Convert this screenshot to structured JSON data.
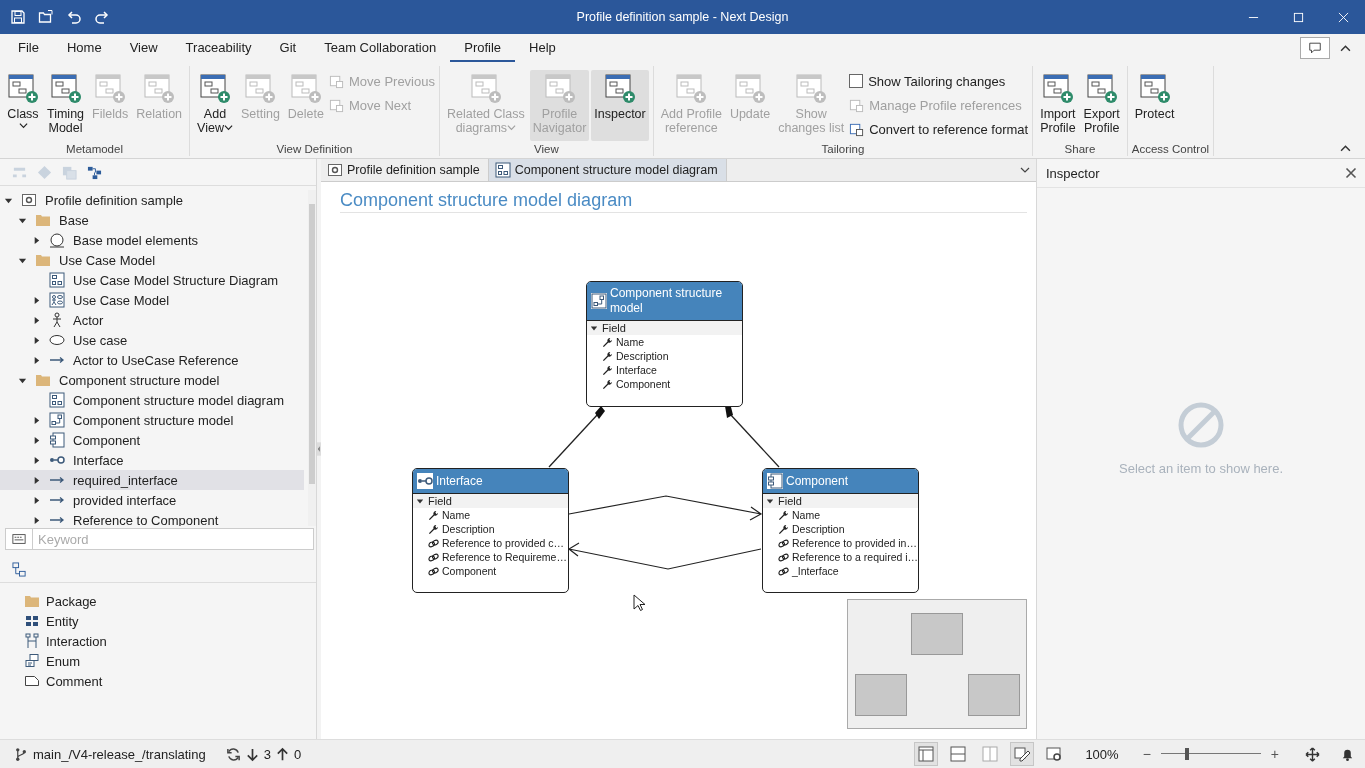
{
  "window": {
    "title": "Profile definition sample - Next Design"
  },
  "menu_tabs": [
    {
      "label": "File",
      "selected": false
    },
    {
      "label": "Home",
      "selected": false
    },
    {
      "label": "View",
      "selected": false
    },
    {
      "label": "Traceability",
      "selected": false
    },
    {
      "label": "Git",
      "selected": false
    },
    {
      "label": "Team Collaboration",
      "selected": false
    },
    {
      "label": "Profile",
      "selected": true
    },
    {
      "label": "Help",
      "selected": false
    }
  ],
  "ribbon_groups": [
    {
      "label": "Metamodel",
      "items": [
        {
          "kind": "large",
          "label": "Class",
          "disabled": false,
          "dropdown": true,
          "pressed": false
        },
        {
          "kind": "large",
          "label": "Timing\nModel",
          "disabled": false,
          "dropdown": false,
          "pressed": false
        },
        {
          "kind": "large",
          "label": "Filelds",
          "disabled": true,
          "dropdown": false,
          "pressed": false
        },
        {
          "kind": "large",
          "label": "Relation",
          "disabled": true,
          "dropdown": false,
          "pressed": false
        }
      ]
    },
    {
      "label": "View Definition",
      "items": [
        {
          "kind": "large",
          "label": "Add\nView",
          "disabled": false,
          "dropdown": true,
          "pressed": false
        },
        {
          "kind": "large",
          "label": "Setting",
          "disabled": true,
          "dropdown": false,
          "pressed": false
        },
        {
          "kind": "large",
          "label": "Delete",
          "disabled": true,
          "dropdown": false,
          "pressed": false
        },
        {
          "kind": "small",
          "label": "Move Previous",
          "disabled": true
        },
        {
          "kind": "small",
          "label": "Move Next",
          "disabled": true
        }
      ]
    },
    {
      "label": "View",
      "items": [
        {
          "kind": "large",
          "label": "Related Class\ndiagrams",
          "disabled": true,
          "dropdown": true,
          "pressed": false
        },
        {
          "kind": "large",
          "label": "Profile\nNavigator",
          "disabled": true,
          "dropdown": false,
          "pressed": true
        },
        {
          "kind": "large",
          "label": "Inspector",
          "disabled": false,
          "dropdown": false,
          "pressed": true
        }
      ]
    },
    {
      "label": "Tailoring",
      "items": [
        {
          "kind": "large",
          "label": "Add Profile\nreference",
          "disabled": true,
          "dropdown": false,
          "pressed": false
        },
        {
          "kind": "large",
          "label": "Update",
          "disabled": true,
          "dropdown": false,
          "pressed": false
        },
        {
          "kind": "large",
          "label": "Show\nchanges list",
          "disabled": true,
          "dropdown": false,
          "pressed": false
        },
        {
          "kind": "checkbox",
          "label": "Show Tailoring changes",
          "disabled": false,
          "checked": false
        },
        {
          "kind": "small",
          "label": "Manage Profile references",
          "disabled": true
        },
        {
          "kind": "small",
          "label": "Convert to reference format",
          "disabled": false
        }
      ]
    },
    {
      "label": "Share",
      "items": [
        {
          "kind": "large",
          "label": "Import\nProfile",
          "disabled": false,
          "dropdown": false,
          "pressed": false
        },
        {
          "kind": "large",
          "label": "Export\nProfile",
          "disabled": false,
          "dropdown": false,
          "pressed": false
        }
      ]
    },
    {
      "label": "Access Control",
      "items": [
        {
          "kind": "large",
          "label": "Protect",
          "disabled": false,
          "dropdown": false,
          "pressed": false
        }
      ]
    }
  ],
  "tree": [
    {
      "label": "Profile definition sample",
      "kind": "profile",
      "expanded": true,
      "selected": false,
      "children": [
        {
          "label": "Base",
          "kind": "folder",
          "expanded": true,
          "selected": false,
          "children": [
            {
              "label": "Base model elements",
              "kind": "base",
              "expanded": false,
              "selected": false
            }
          ]
        },
        {
          "label": "Use Case Model",
          "kind": "folder",
          "expanded": true,
          "selected": false,
          "children": [
            {
              "label": "Use Case Model Structure Diagram",
              "kind": "diagram",
              "selected": false
            },
            {
              "label": "Use Case Model",
              "kind": "usecase-model",
              "expanded": false,
              "selected": false
            },
            {
              "label": "Actor",
              "kind": "actor",
              "expanded": false,
              "selected": false
            },
            {
              "label": "Use case",
              "kind": "usecase",
              "expanded": false,
              "selected": false
            },
            {
              "label": "Actor to UseCase Reference",
              "kind": "reference",
              "expanded": false,
              "selected": false
            }
          ]
        },
        {
          "label": "Component structure model",
          "kind": "folder",
          "expanded": true,
          "selected": false,
          "children": [
            {
              "label": "Component structure model diagram",
              "kind": "diagram",
              "selected": false
            },
            {
              "label": "Component structure model",
              "kind": "structure-model",
              "expanded": false,
              "selected": false
            },
            {
              "label": "Component",
              "kind": "component",
              "expanded": false,
              "selected": false
            },
            {
              "label": "Interface",
              "kind": "interface",
              "expanded": false,
              "selected": false
            },
            {
              "label": "required_interface",
              "kind": "reference",
              "expanded": false,
              "selected": true
            },
            {
              "label": "provided interface",
              "kind": "reference",
              "expanded": false,
              "selected": false
            },
            {
              "label": "Reference to Component",
              "kind": "reference",
              "expanded": false,
              "selected": false
            }
          ]
        }
      ]
    }
  ],
  "keyword": {
    "placeholder": "Keyword"
  },
  "palette": [
    {
      "label": "Package",
      "kind": "package"
    },
    {
      "label": "Entity",
      "kind": "entity"
    },
    {
      "label": "Interaction",
      "kind": "interaction"
    },
    {
      "label": "Enum",
      "kind": "enum"
    },
    {
      "label": "Comment",
      "kind": "comment"
    }
  ],
  "editor_tabs": [
    {
      "label": "Profile definition sample",
      "kind": "profile",
      "selected": false
    },
    {
      "label": "Component structure model diagram",
      "kind": "diagram",
      "selected": true
    }
  ],
  "diagram": {
    "title": "Component structure model diagram",
    "nodes": [
      {
        "title": "Component structure model",
        "kind": "structure-model",
        "section": "Field",
        "expanded": true,
        "fields": [
          {
            "label": "Name",
            "kind": "attribute"
          },
          {
            "label": "Description",
            "kind": "attribute"
          },
          {
            "label": "Interface",
            "kind": "attribute"
          },
          {
            "label": "Component",
            "kind": "attribute"
          }
        ]
      },
      {
        "title": "Interface",
        "kind": "interface",
        "section": "Field",
        "expanded": true,
        "fields": [
          {
            "label": "Name",
            "kind": "attribute"
          },
          {
            "label": "Description",
            "kind": "attribute"
          },
          {
            "label": "Reference to provided c…",
            "kind": "reference"
          },
          {
            "label": "Reference to Requireme…",
            "kind": "reference"
          },
          {
            "label": "Component",
            "kind": "reference"
          }
        ]
      },
      {
        "title": "Component",
        "kind": "component",
        "section": "Field",
        "expanded": true,
        "fields": [
          {
            "label": "Name",
            "kind": "attribute"
          },
          {
            "label": "Description",
            "kind": "attribute"
          },
          {
            "label": "Reference to provided in…",
            "kind": "reference"
          },
          {
            "label": "Reference to a required i…",
            "kind": "reference"
          },
          {
            "label": "_Interface",
            "kind": "reference"
          }
        ]
      }
    ]
  },
  "inspector": {
    "title": "Inspector",
    "message": "Select an item to show here."
  },
  "status": {
    "branch": "main_/V4-release_/translating",
    "incoming": "3",
    "outgoing": "0",
    "zoom": "100%",
    "zoom_out": "−",
    "zoom_in": "+",
    "zoom_slider": {
      "level": 0.26
    }
  }
}
